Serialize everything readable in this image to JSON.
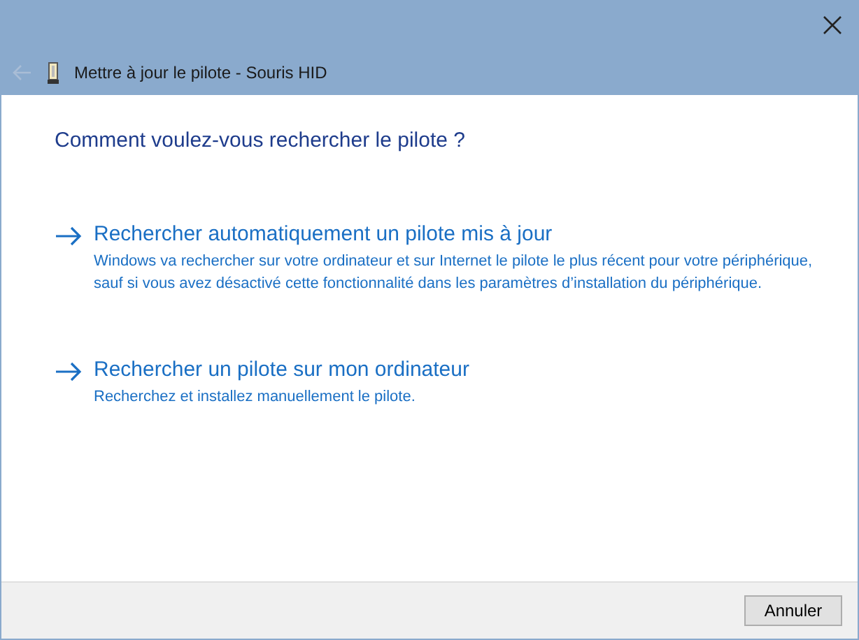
{
  "window": {
    "title": "Mettre à jour le pilote - Souris HID"
  },
  "heading": "Comment voulez-vous rechercher le pilote ?",
  "options": [
    {
      "title": "Rechercher automatiquement un pilote mis à jour",
      "description": "Windows va rechercher sur votre ordinateur et sur Internet le pilote le plus récent pour votre périphérique, sauf si vous avez désactivé cette fonctionnalité dans les paramètres d’installation du périphérique."
    },
    {
      "title": "Rechercher un pilote sur mon ordinateur",
      "description": "Recherchez et installez manuellement le pilote."
    }
  ],
  "buttons": [
    "Annuler"
  ]
}
